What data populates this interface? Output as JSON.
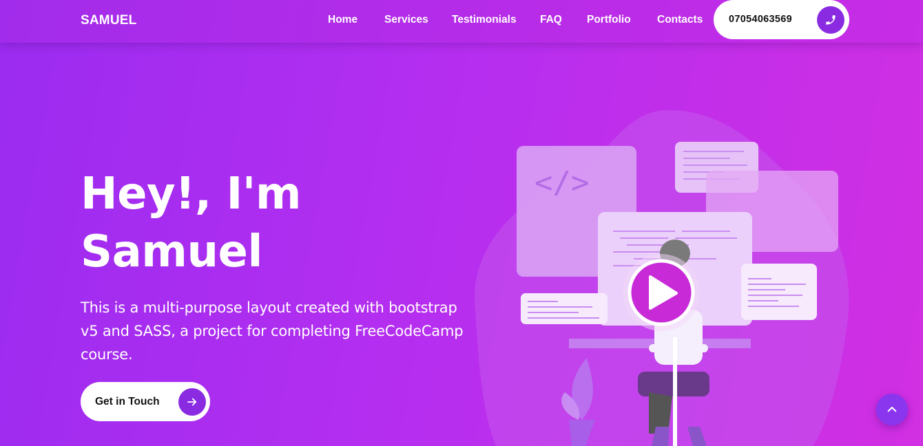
{
  "nav": {
    "brand": "SAMUEL",
    "links": [
      "Home",
      "Services",
      "Testimonials",
      "FAQ",
      "Portfolio",
      "Contacts"
    ],
    "phone": "07054063569",
    "phone_icon": "phone-icon"
  },
  "hero": {
    "title_line1": "Hey!, I'm",
    "title_line2": "Samuel",
    "description": "This is a multi-purpose layout created with bootstrap v5 and SASS, a project for completing FreeCodeCamp course.",
    "cta_label": "Get in Touch",
    "cta_icon": "arrow-right-icon"
  },
  "illustration": {
    "code_symbol": "</>",
    "play_icon": "play-icon"
  },
  "scroll_top_icon": "chevron-up-icon",
  "colors": {
    "accent": "#8a2be2",
    "gradient_start": "#9b2cf0",
    "gradient_end": "#d12fe2",
    "play": "#c82ad8"
  }
}
